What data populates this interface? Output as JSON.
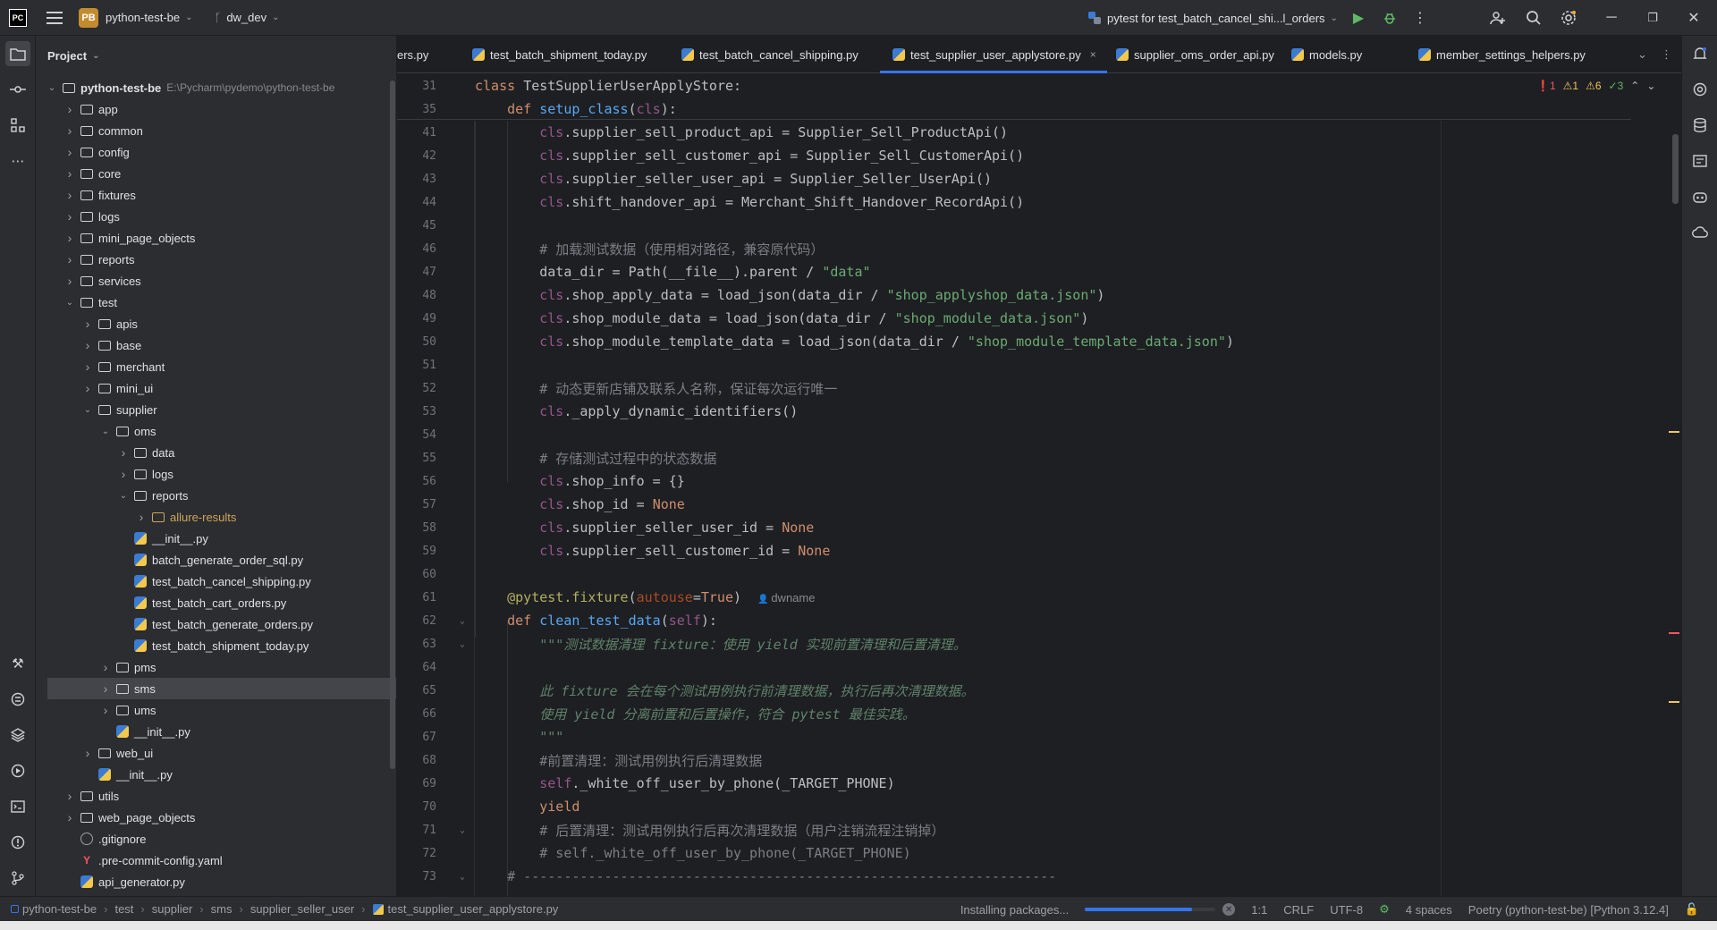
{
  "titlebar": {
    "app_logo": "PC",
    "project_badge": "PB",
    "project_name": "python-test-be",
    "branch": "dw_dev",
    "run_config": "pytest for test_batch_cancel_shi...l_orders"
  },
  "project_panel": {
    "title": "Project",
    "tree": [
      {
        "label": "python-test-be",
        "path": "E:\\Pycharm\\pydemo\\python-test-be",
        "type": "folder",
        "depth": 0,
        "open": true
      },
      {
        "label": "app",
        "type": "folder",
        "depth": 1
      },
      {
        "label": "common",
        "type": "folder",
        "depth": 1
      },
      {
        "label": "config",
        "type": "folder",
        "depth": 1
      },
      {
        "label": "core",
        "type": "folder",
        "depth": 1
      },
      {
        "label": "fixtures",
        "type": "folder",
        "depth": 1
      },
      {
        "label": "logs",
        "type": "folder",
        "depth": 1
      },
      {
        "label": "mini_page_objects",
        "type": "folder",
        "depth": 1
      },
      {
        "label": "reports",
        "type": "folder",
        "depth": 1
      },
      {
        "label": "services",
        "type": "folder",
        "depth": 1
      },
      {
        "label": "test",
        "type": "folder",
        "depth": 1,
        "open": true
      },
      {
        "label": "apis",
        "type": "folder",
        "depth": 2
      },
      {
        "label": "base",
        "type": "folder",
        "depth": 2
      },
      {
        "label": "merchant",
        "type": "folder",
        "depth": 2
      },
      {
        "label": "mini_ui",
        "type": "folder",
        "depth": 2
      },
      {
        "label": "supplier",
        "type": "folder",
        "depth": 2,
        "open": true
      },
      {
        "label": "oms",
        "type": "folder",
        "depth": 3,
        "open": true
      },
      {
        "label": "data",
        "type": "folder",
        "depth": 4
      },
      {
        "label": "logs",
        "type": "folder",
        "depth": 4
      },
      {
        "label": "reports",
        "type": "folder",
        "depth": 4,
        "open": true
      },
      {
        "label": "allure-results",
        "type": "folder-orange",
        "depth": 5
      },
      {
        "label": "__init__.py",
        "type": "py",
        "depth": 4
      },
      {
        "label": "batch_generate_order_sql.py",
        "type": "py",
        "depth": 4
      },
      {
        "label": "test_batch_cancel_shipping.py",
        "type": "py",
        "depth": 4
      },
      {
        "label": "test_batch_cart_orders.py",
        "type": "py",
        "depth": 4
      },
      {
        "label": "test_batch_generate_orders.py",
        "type": "py",
        "depth": 4
      },
      {
        "label": "test_batch_shipment_today.py",
        "type": "py",
        "depth": 4
      },
      {
        "label": "pms",
        "type": "folder",
        "depth": 3
      },
      {
        "label": "sms",
        "type": "folder",
        "depth": 3,
        "selected": true
      },
      {
        "label": "ums",
        "type": "folder",
        "depth": 3
      },
      {
        "label": "__init__.py",
        "type": "py",
        "depth": 3
      },
      {
        "label": "web_ui",
        "type": "folder",
        "depth": 2
      },
      {
        "label": "__init__.py",
        "type": "py",
        "depth": 2
      },
      {
        "label": "utils",
        "type": "folder",
        "depth": 1
      },
      {
        "label": "web_page_objects",
        "type": "folder",
        "depth": 1
      },
      {
        "label": ".gitignore",
        "type": "git",
        "depth": 1
      },
      {
        "label": ".pre-commit-config.yaml",
        "type": "yaml",
        "depth": 1
      },
      {
        "label": "api_generator.py",
        "type": "py",
        "depth": 1
      }
    ]
  },
  "tabs": [
    {
      "label": "ers.py",
      "icon": false
    },
    {
      "label": "test_batch_shipment_today.py",
      "icon": true
    },
    {
      "label": "test_batch_cancel_shipping.py",
      "icon": true
    },
    {
      "label": "test_supplier_user_applystore.py",
      "icon": true,
      "active": true,
      "close": "×"
    },
    {
      "label": "supplier_oms_order_api.py",
      "icon": true
    },
    {
      "label": "models.py",
      "icon": true
    },
    {
      "label": "member_settings_helpers.py",
      "icon": true
    }
  ],
  "inspections": {
    "errors": "1",
    "warnings": "1",
    "weak_warnings": "6",
    "ok": "3"
  },
  "code_lines": [
    {
      "n": "31",
      "sticky": true,
      "parts": [
        [
          "k",
          "class "
        ],
        [
          "",
          "TestSupplierUserApplyStore:"
        ]
      ]
    },
    {
      "n": "35",
      "sticky": true,
      "parts": [
        [
          "",
          "    "
        ],
        [
          "k",
          "def "
        ],
        [
          "f",
          "setup_class"
        ],
        [
          "",
          "("
        ],
        [
          "selfc",
          "cls"
        ],
        [
          "",
          "):"
        ]
      ]
    },
    {
      "n": "41",
      "parts": [
        [
          "",
          "        "
        ],
        [
          "selfc",
          "cls"
        ],
        [
          "",
          ".supplier_sell_product_api = Supplier_Sell_ProductApi()"
        ]
      ]
    },
    {
      "n": "42",
      "parts": [
        [
          "",
          "        "
        ],
        [
          "selfc",
          "cls"
        ],
        [
          "",
          ".supplier_sell_customer_api = Supplier_Sell_CustomerApi()"
        ]
      ]
    },
    {
      "n": "43",
      "parts": [
        [
          "",
          "        "
        ],
        [
          "selfc",
          "cls"
        ],
        [
          "",
          ".supplier_seller_user_api = Supplier_Seller_UserApi()"
        ]
      ]
    },
    {
      "n": "44",
      "parts": [
        [
          "",
          "        "
        ],
        [
          "selfc",
          "cls"
        ],
        [
          "",
          ".shift_handover_api = Merchant_Shift_Handover_RecordApi()"
        ]
      ]
    },
    {
      "n": "45",
      "parts": []
    },
    {
      "n": "46",
      "parts": [
        [
          "",
          "        "
        ],
        [
          "c",
          "# 加载测试数据（使用相对路径，兼容原代码）"
        ]
      ]
    },
    {
      "n": "47",
      "parts": [
        [
          "",
          "        data_dir = Path(__file__).parent / "
        ],
        [
          "s",
          "\"data\""
        ]
      ]
    },
    {
      "n": "48",
      "parts": [
        [
          "",
          "        "
        ],
        [
          "selfc",
          "cls"
        ],
        [
          "",
          ".shop_apply_data = load_json(data_dir / "
        ],
        [
          "s",
          "\"shop_applyshop_data.json\""
        ],
        [
          "",
          ")"
        ]
      ]
    },
    {
      "n": "49",
      "parts": [
        [
          "",
          "        "
        ],
        [
          "selfc",
          "cls"
        ],
        [
          "",
          ".shop_module_data = load_json(data_dir / "
        ],
        [
          "s",
          "\"shop_module_data.json\""
        ],
        [
          "",
          ")"
        ]
      ]
    },
    {
      "n": "50",
      "parts": [
        [
          "",
          "        "
        ],
        [
          "selfc",
          "cls"
        ],
        [
          "",
          ".shop_module_template_data = load_json(data_dir / "
        ],
        [
          "s",
          "\"shop_module_template_data.json\""
        ],
        [
          "",
          ")"
        ]
      ]
    },
    {
      "n": "51",
      "parts": []
    },
    {
      "n": "52",
      "parts": [
        [
          "",
          "        "
        ],
        [
          "c",
          "# 动态更新店铺及联系人名称，保证每次运行唯一"
        ]
      ]
    },
    {
      "n": "53",
      "parts": [
        [
          "",
          "        "
        ],
        [
          "selfc",
          "cls"
        ],
        [
          "",
          "._apply_dynamic_identifiers()"
        ]
      ]
    },
    {
      "n": "54",
      "parts": []
    },
    {
      "n": "55",
      "parts": [
        [
          "",
          "        "
        ],
        [
          "c",
          "# 存储测试过程中的状态数据"
        ]
      ]
    },
    {
      "n": "56",
      "parts": [
        [
          "",
          "        "
        ],
        [
          "selfc",
          "cls"
        ],
        [
          "",
          ".shop_info = {}"
        ]
      ]
    },
    {
      "n": "57",
      "parts": [
        [
          "",
          "        "
        ],
        [
          "selfc",
          "cls"
        ],
        [
          "",
          ".shop_id = "
        ],
        [
          "k",
          "None"
        ]
      ]
    },
    {
      "n": "58",
      "parts": [
        [
          "",
          "        "
        ],
        [
          "selfc",
          "cls"
        ],
        [
          "",
          ".supplier_seller_user_id = "
        ],
        [
          "k",
          "None"
        ]
      ]
    },
    {
      "n": "59",
      "parts": [
        [
          "",
          "        "
        ],
        [
          "selfc",
          "cls"
        ],
        [
          "",
          ".supplier_sell_customer_id = "
        ],
        [
          "k",
          "None"
        ]
      ]
    },
    {
      "n": "60",
      "parts": []
    },
    {
      "n": "61",
      "parts": [
        [
          "",
          "    "
        ],
        [
          "deco",
          "@pytest.fixture"
        ],
        [
          "",
          "("
        ],
        [
          "param",
          "autouse"
        ],
        [
          "",
          "="
        ],
        [
          "k",
          "True"
        ],
        [
          "",
          ")  "
        ]
      ],
      "hint": "dwname"
    },
    {
      "n": "62",
      "fold": true,
      "parts": [
        [
          "",
          "    "
        ],
        [
          "k",
          "def "
        ],
        [
          "f",
          "clean_test_data"
        ],
        [
          "",
          "("
        ],
        [
          "selfc",
          "self"
        ],
        [
          "",
          "):"
        ]
      ]
    },
    {
      "n": "63",
      "fold": true,
      "parts": [
        [
          "",
          "        "
        ],
        [
          "doc",
          "\"\"\"测试数据清理 fixture：使用 yield 实现前置清理和后置清理。"
        ]
      ]
    },
    {
      "n": "64",
      "parts": []
    },
    {
      "n": "65",
      "parts": [
        [
          "",
          "        "
        ],
        [
          "doc",
          "此 fixture 会在每个测试用例执行前清理数据，执行后再次清理数据。"
        ]
      ]
    },
    {
      "n": "66",
      "parts": [
        [
          "",
          "        "
        ],
        [
          "doc",
          "使用 yield 分离前置和后置操作，符合 pytest 最佳实践。"
        ]
      ]
    },
    {
      "n": "67",
      "parts": [
        [
          "",
          "        "
        ],
        [
          "doc",
          "\"\"\""
        ]
      ]
    },
    {
      "n": "68",
      "parts": [
        [
          "",
          "        "
        ],
        [
          "c",
          "#前置清理：测试用例执行后清理数据"
        ]
      ]
    },
    {
      "n": "69",
      "parts": [
        [
          "",
          "        "
        ],
        [
          "selfc",
          "self"
        ],
        [
          "",
          "._white_off_user_by_phone(_TARGET_PHONE)"
        ]
      ]
    },
    {
      "n": "70",
      "parts": [
        [
          "",
          "        "
        ],
        [
          "k",
          "yield"
        ]
      ]
    },
    {
      "n": "71",
      "fold": true,
      "parts": [
        [
          "",
          "        "
        ],
        [
          "c",
          "# 后置清理：测试用例执行后再次清理数据（用户注销流程注销掉）"
        ]
      ]
    },
    {
      "n": "72",
      "parts": [
        [
          "",
          "        "
        ],
        [
          "c",
          "# self._white_off_user_by_phone(_TARGET_PHONE)"
        ]
      ]
    },
    {
      "n": "73",
      "fold": true,
      "parts": [
        [
          "",
          "    "
        ],
        [
          "c",
          "# ------------------------------------------------------------------"
        ]
      ]
    }
  ],
  "statusbar": {
    "breadcrumbs": [
      "python-test-be",
      "test",
      "supplier",
      "sms",
      "supplier_seller_user",
      "test_supplier_user_applystore.py"
    ],
    "task": "Installing packages...",
    "progress": 0.82,
    "position": "1:1",
    "line_sep": "CRLF",
    "encoding": "UTF-8",
    "indent": "4 spaces",
    "interpreter": "Poetry (python-test-be) [Python 3.12.4]"
  },
  "colors": {
    "accent": "#3574f0",
    "error": "#f75464",
    "warning": "#f2c55c"
  }
}
